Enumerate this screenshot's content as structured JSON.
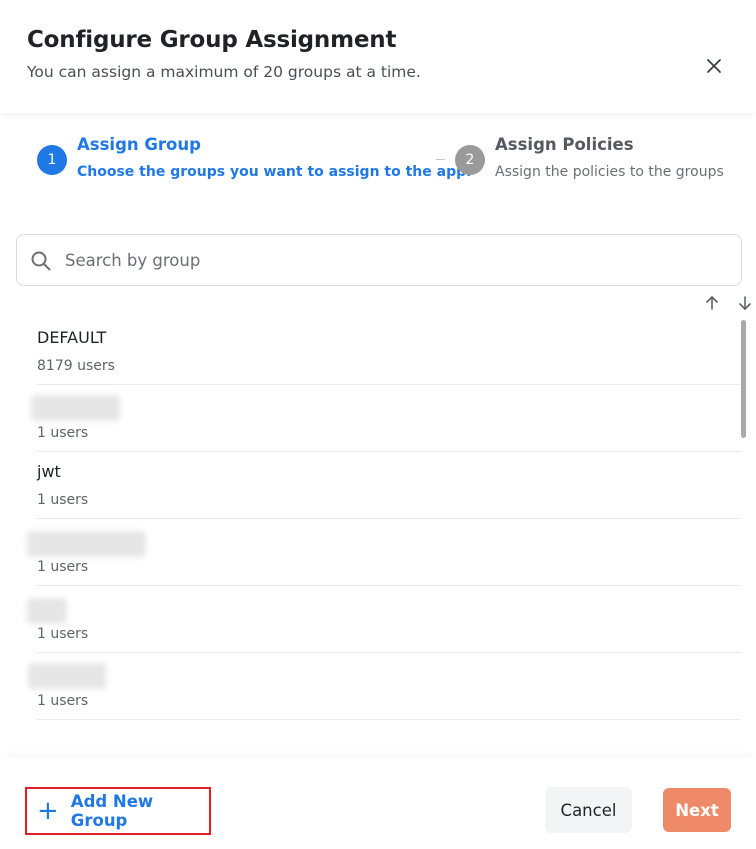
{
  "dialog": {
    "title": "Configure Group Assignment",
    "subtitle": "You can assign a maximum of 20 groups at a time."
  },
  "stepper": {
    "steps": [
      {
        "number": "1",
        "title": "Assign Group",
        "description": "Choose the groups you want to assign to the app.",
        "state": "active"
      },
      {
        "number": "2",
        "title": "Assign Policies",
        "description": "Assign the policies to the groups",
        "state": "inactive"
      }
    ]
  },
  "search": {
    "placeholder": "Search by group",
    "value": ""
  },
  "groups": [
    {
      "name": "DEFAULT",
      "users": "8179 users",
      "redacted": false
    },
    {
      "name": "",
      "users": "1 users",
      "redacted": true
    },
    {
      "name": "jwt",
      "users": "1 users",
      "redacted": false
    },
    {
      "name": "",
      "users": "1 users",
      "redacted": true
    },
    {
      "name": "",
      "users": "1 users",
      "redacted": true
    },
    {
      "name": "",
      "users": "1 users",
      "redacted": true
    }
  ],
  "footer": {
    "add_group_label": "Add New Group",
    "cancel_label": "Cancel",
    "next_label": "Next"
  },
  "icons": {
    "close": "close-icon",
    "search": "search-icon",
    "sort_up": "arrow-up-icon",
    "sort_down": "arrow-down-icon",
    "add": "plus-icon"
  },
  "colors": {
    "accent": "#1f78e4",
    "next_button": "#ef8a68",
    "inactive_step": "#9a9a9a",
    "highlight_border": "#e01e26"
  }
}
